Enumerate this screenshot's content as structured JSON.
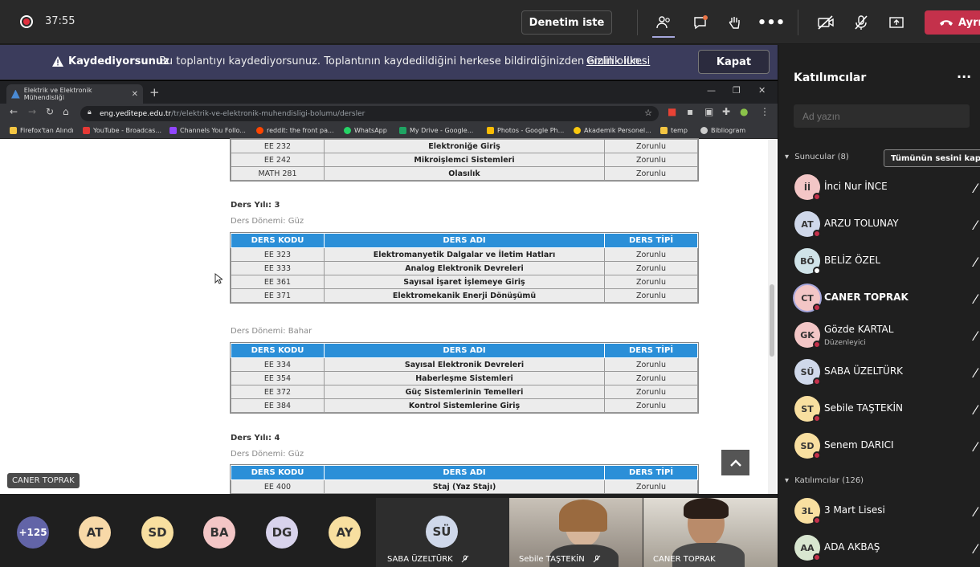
{
  "topbar": {
    "timer": "37:55",
    "audit_button": "Denetim iste",
    "leave_button": "Ayrıl",
    "icons": [
      "participants-icon",
      "chat-icon",
      "raise-hand-icon",
      "more-icon",
      "camera-off-icon",
      "mic-off-icon",
      "share-icon",
      "phone-icon"
    ]
  },
  "banner": {
    "title": "Kaydediyorsunuz",
    "text": "Bu toplantıyı kaydediyorsunuz. Toplantının kaydedildiğini herkese bildirdiğinizden emin olun.",
    "link": "Gizlilik ilkesi",
    "close_button": "Kapat"
  },
  "browser": {
    "tab_title": "Elektrik ve Elektronik Mühendisliği",
    "url_host": "eng.yeditepe.edu.tr",
    "url_path": "/tr/elektrik-ve-elektronik-muhendisligi-bolumu/dersler",
    "bookmarks": [
      "Firefox'tan Alındı",
      "YouTube - Broadcas...",
      "Channels You Follo...",
      "reddit: the front pa...",
      "WhatsApp",
      "My Drive - Google...",
      "Photos - Google Ph...",
      "Akademik Personel...",
      "temp",
      "Bibliogram"
    ]
  },
  "page": {
    "headers": {
      "code": "DERS KODU",
      "name": "DERS ADI",
      "type": "DERS TİPİ"
    },
    "top_rows": [
      {
        "code": "EE 232",
        "name": "Elektroniğe Giriş",
        "type": "Zorunlu"
      },
      {
        "code": "EE 242",
        "name": "Mikroişlemci Sistemleri",
        "type": "Zorunlu"
      },
      {
        "code": "MATH 281",
        "name": "Olasılık",
        "type": "Zorunlu"
      }
    ],
    "year3": "Ders Yılı: 3",
    "fall": "Ders Dönemi: Güz",
    "year3_fall": [
      {
        "code": "EE 323",
        "name": "Elektromanyetik Dalgalar ve İletim Hatları",
        "type": "Zorunlu"
      },
      {
        "code": "EE 333",
        "name": "Analog Elektronik Devreleri",
        "type": "Zorunlu"
      },
      {
        "code": "EE 361",
        "name": "Sayısal İşaret İşlemeye Giriş",
        "type": "Zorunlu"
      },
      {
        "code": "EE 371",
        "name": "Elektromekanik Enerji Dönüşümü",
        "type": "Zorunlu"
      }
    ],
    "spring": "Ders Dönemi: Bahar",
    "year3_spring": [
      {
        "code": "EE 334",
        "name": "Sayısal Elektronik Devreleri",
        "type": "Zorunlu"
      },
      {
        "code": "EE 354",
        "name": "Haberleşme Sistemleri",
        "type": "Zorunlu"
      },
      {
        "code": "EE 372",
        "name": "Güç Sistemlerinin Temelleri",
        "type": "Zorunlu"
      },
      {
        "code": "EE 384",
        "name": "Kontrol Sistemlerine Giriş",
        "type": "Zorunlu"
      }
    ],
    "year4": "Ders Yılı: 4",
    "year4_fall": [
      {
        "code": "EE 400",
        "name": "Staj (Yaz Stajı)",
        "type": "Zorunlu"
      }
    ]
  },
  "presenter_label": "CANER TOPRAK",
  "strip": {
    "avatars": [
      {
        "text": "+125",
        "color": "#6264a7"
      },
      {
        "text": "AT",
        "color": "#f8d9a8"
      },
      {
        "text": "SD",
        "color": "#f8dfa0"
      },
      {
        "text": "BA",
        "color": "#f3c6c6"
      },
      {
        "text": "DG",
        "color": "#d8d3ec"
      },
      {
        "text": "AY",
        "color": "#f8dfa0"
      }
    ],
    "tiles": [
      {
        "name": "SABA ÜZELTÜRK",
        "initials": "SÜ"
      },
      {
        "name": "Sebile TAŞTEKİN"
      },
      {
        "name": "CANER TOPRAK"
      }
    ]
  },
  "panel": {
    "title": "Katılımcılar",
    "search_placeholder": "Ad yazın",
    "presenters_label": "Sunucular (8)",
    "mute_all": "Tümünün sesini kapat",
    "presenters": [
      {
        "initials": "İİ",
        "name": "İnci Nur İNCE",
        "color": "#f3c6c6"
      },
      {
        "initials": "AT",
        "name": "ARZU TOLUNAY",
        "color": "#cfd8ea"
      },
      {
        "initials": "BÖ",
        "name": "BELİZ ÖZEL",
        "color": "#cfe3e8"
      },
      {
        "initials": "CT",
        "name": "CANER TOPRAK",
        "color": "#f3c6c6"
      },
      {
        "initials": "GK",
        "name": "Gözde KARTAL",
        "role": "Düzenleyici",
        "color": "#f3c6c6"
      },
      {
        "initials": "SÜ",
        "name": "SABA ÜZELTÜRK",
        "color": "#cfd8ea"
      },
      {
        "initials": "ST",
        "name": "Sebile TAŞTEKİN",
        "color": "#f8dfa0"
      },
      {
        "initials": "SD",
        "name": "Senem DARICI",
        "color": "#f8dfa0"
      }
    ],
    "attendees_label": "Katılımcılar (126)",
    "attendees": [
      {
        "initials": "3L",
        "name": "3 Mart Lisesi",
        "color": "#f8dfa0"
      },
      {
        "initials": "AA",
        "name": "ADA AKBAŞ",
        "color": "#d8e6d0"
      }
    ]
  }
}
